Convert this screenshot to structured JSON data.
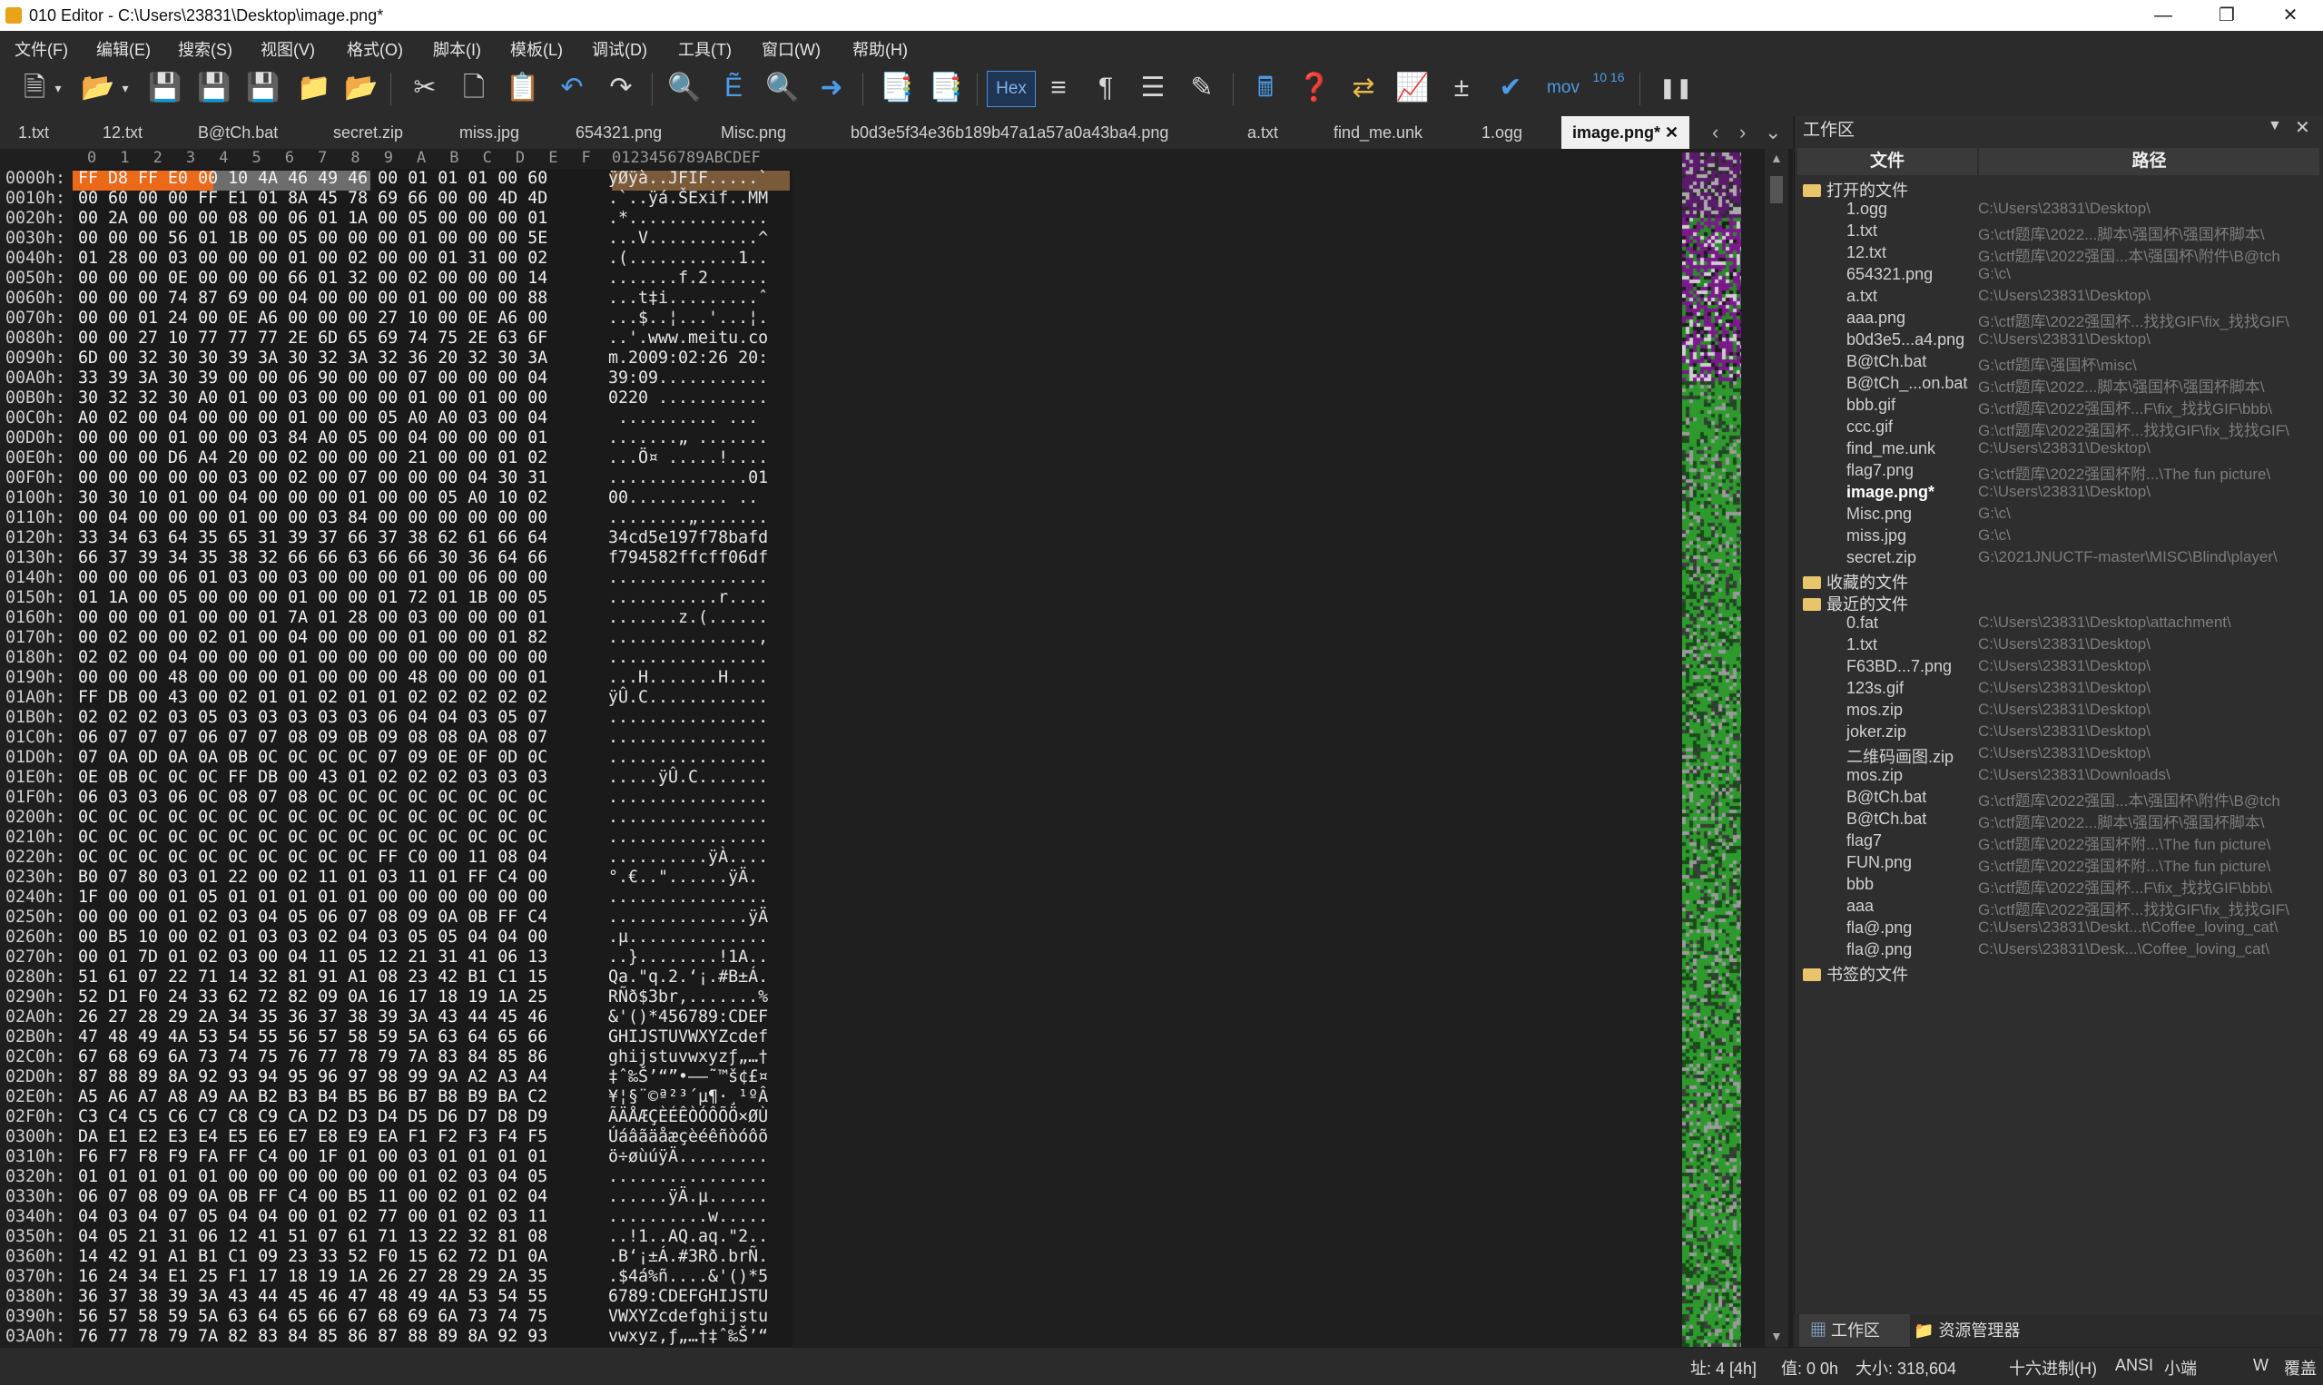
{
  "window": {
    "title": "010 Editor - C:\\Users\\23831\\Desktop\\image.png*"
  },
  "menu": [
    "文件(F)",
    "编辑(E)",
    "搜索(S)",
    "视图(V)",
    "格式(O)",
    "脚本(I)",
    "模板(L)",
    "调试(D)",
    "工具(T)",
    "窗口(W)",
    "帮助(H)"
  ],
  "toolbar": {
    "hex_label": "Hex",
    "mov_label": "mov",
    "base_label": "10 16"
  },
  "tabs": [
    "1.txt",
    "12.txt",
    "B@tCh.bat",
    "secret.zip",
    "miss.jpg",
    "654321.png",
    "Misc.png",
    "b0d3e5f34e36b189b47a1a57a0a43ba4.png",
    "a.txt",
    "find_me.unk",
    "1.ogg",
    "image.png*"
  ],
  "hex_header": {
    "cols": [
      "0",
      "1",
      "2",
      "3",
      "4",
      "5",
      "6",
      "7",
      "8",
      "9",
      "A",
      "B",
      "C",
      "D",
      "E",
      "F"
    ],
    "ascii": "0123456789ABCDEF"
  },
  "hex_rows": [
    {
      "a": "0000h:",
      "h": "FF D8 FF E0 00 10 4A 46 49 46 00 01 01 01 00 60",
      "s": "ÿØÿà..JFIF.....`"
    },
    {
      "a": "0010h:",
      "h": "00 60 00 00 FF E1 01 8A 45 78 69 66 00 00 4D 4D",
      "s": ".`..ÿá.ŠExif..MM"
    },
    {
      "a": "0020h:",
      "h": "00 2A 00 00 00 08 00 06 01 1A 00 05 00 00 00 01",
      "s": ".*.............."
    },
    {
      "a": "0030h:",
      "h": "00 00 00 56 01 1B 00 05 00 00 00 01 00 00 00 5E",
      "s": "...V...........^"
    },
    {
      "a": "0040h:",
      "h": "01 28 00 03 00 00 00 01 00 02 00 00 01 31 00 02",
      "s": ".(...........1.."
    },
    {
      "a": "0050h:",
      "h": "00 00 00 0E 00 00 00 66 01 32 00 02 00 00 00 14",
      "s": ".......f.2......"
    },
    {
      "a": "0060h:",
      "h": "00 00 00 74 87 69 00 04 00 00 00 01 00 00 00 88",
      "s": "...t‡i.........ˆ"
    },
    {
      "a": "0070h:",
      "h": "00 00 01 24 00 0E A6 00 00 00 27 10 00 0E A6 00",
      "s": "...$..¦...'...¦."
    },
    {
      "a": "0080h:",
      "h": "00 00 27 10 77 77 77 2E 6D 65 69 74 75 2E 63 6F",
      "s": "..'.www.meitu.co"
    },
    {
      "a": "0090h:",
      "h": "6D 00 32 30 30 39 3A 30 32 3A 32 36 20 32 30 3A",
      "s": "m.2009:02:26 20:"
    },
    {
      "a": "00A0h:",
      "h": "33 39 3A 30 39 00 00 06 90 00 00 07 00 00 00 04",
      "s": "39:09..........."
    },
    {
      "a": "00B0h:",
      "h": "30 32 32 30 A0 01 00 03 00 00 00 01 00 01 00 00",
      "s": "0220 ..........."
    },
    {
      "a": "00C0h:",
      "h": "A0 02 00 04 00 00 00 01 00 00 05 A0 A0 03 00 04",
      "s": " .......... ..."
    },
    {
      "a": "00D0h:",
      "h": "00 00 00 01 00 00 03 84 A0 05 00 04 00 00 00 01",
      "s": ".......„ ......."
    },
    {
      "a": "00E0h:",
      "h": "00 00 00 D6 A4 20 00 02 00 00 00 21 00 00 01 02",
      "s": "...Ö¤ .....!...."
    },
    {
      "a": "00F0h:",
      "h": "00 00 00 00 00 03 00 02 00 07 00 00 00 04 30 31",
      "s": "..............01"
    },
    {
      "a": "0100h:",
      "h": "30 30 10 01 00 04 00 00 00 01 00 00 05 A0 10 02",
      "s": "00.......... .."
    },
    {
      "a": "0110h:",
      "h": "00 04 00 00 00 01 00 00 03 84 00 00 00 00 00 00",
      "s": "........„......."
    },
    {
      "a": "0120h:",
      "h": "33 34 63 64 35 65 31 39 37 66 37 38 62 61 66 64",
      "s": "34cd5e197f78bafd"
    },
    {
      "a": "0130h:",
      "h": "66 37 39 34 35 38 32 66 66 63 66 66 30 36 64 66",
      "s": "f794582ffcff06df"
    },
    {
      "a": "0140h:",
      "h": "00 00 00 06 01 03 00 03 00 00 00 01 00 06 00 00",
      "s": "................"
    },
    {
      "a": "0150h:",
      "h": "01 1A 00 05 00 00 00 01 00 00 01 72 01 1B 00 05",
      "s": "...........r...."
    },
    {
      "a": "0160h:",
      "h": "00 00 00 01 00 00 01 7A 01 28 00 03 00 00 00 01",
      "s": ".......z.(......"
    },
    {
      "a": "0170h:",
      "h": "00 02 00 00 02 01 00 04 00 00 00 01 00 00 01 82",
      "s": "...............‚"
    },
    {
      "a": "0180h:",
      "h": "02 02 00 04 00 00 00 01 00 00 00 00 00 00 00 00",
      "s": "................"
    },
    {
      "a": "0190h:",
      "h": "00 00 00 48 00 00 00 01 00 00 00 48 00 00 00 01",
      "s": "...H.......H...."
    },
    {
      "a": "01A0h:",
      "h": "FF DB 00 43 00 02 01 01 02 01 01 02 02 02 02 02",
      "s": "ÿÛ.C............"
    },
    {
      "a": "01B0h:",
      "h": "02 02 02 03 05 03 03 03 03 03 06 04 04 03 05 07",
      "s": "................"
    },
    {
      "a": "01C0h:",
      "h": "06 07 07 07 06 07 07 08 09 0B 09 08 08 0A 08 07",
      "s": "................"
    },
    {
      "a": "01D0h:",
      "h": "07 0A 0D 0A 0A 0B 0C 0C 0C 0C 07 09 0E 0F 0D 0C",
      "s": "................"
    },
    {
      "a": "01E0h:",
      "h": "0E 0B 0C 0C 0C FF DB 00 43 01 02 02 02 03 03 03",
      "s": ".....ÿÛ.C......."
    },
    {
      "a": "01F0h:",
      "h": "06 03 03 06 0C 08 07 08 0C 0C 0C 0C 0C 0C 0C 0C",
      "s": "................"
    },
    {
      "a": "0200h:",
      "h": "0C 0C 0C 0C 0C 0C 0C 0C 0C 0C 0C 0C 0C 0C 0C 0C",
      "s": "................"
    },
    {
      "a": "0210h:",
      "h": "0C 0C 0C 0C 0C 0C 0C 0C 0C 0C 0C 0C 0C 0C 0C 0C",
      "s": "................"
    },
    {
      "a": "0220h:",
      "h": "0C 0C 0C 0C 0C 0C 0C 0C 0C 0C FF C0 00 11 08 04",
      "s": "..........ÿÀ...."
    },
    {
      "a": "0230h:",
      "h": "B0 07 80 03 01 22 00 02 11 01 03 11 01 FF C4 00",
      "s": "°.€..\"......ÿÄ."
    },
    {
      "a": "0240h:",
      "h": "1F 00 00 01 05 01 01 01 01 01 00 00 00 00 00 00",
      "s": "................"
    },
    {
      "a": "0250h:",
      "h": "00 00 00 01 02 03 04 05 06 07 08 09 0A 0B FF C4",
      "s": "..............ÿÄ"
    },
    {
      "a": "0260h:",
      "h": "00 B5 10 00 02 01 03 03 02 04 03 05 05 04 04 00",
      "s": ".µ.............."
    },
    {
      "a": "0270h:",
      "h": "00 01 7D 01 02 03 00 04 11 05 12 21 31 41 06 13",
      "s": "..}........!1A.."
    },
    {
      "a": "0280h:",
      "h": "51 61 07 22 71 14 32 81 91 A1 08 23 42 B1 C1 15",
      "s": "Qa.\"q.2.‘¡.#B±Á."
    },
    {
      "a": "0290h:",
      "h": "52 D1 F0 24 33 62 72 82 09 0A 16 17 18 19 1A 25",
      "s": "RÑð$3br‚.......%"
    },
    {
      "a": "02A0h:",
      "h": "26 27 28 29 2A 34 35 36 37 38 39 3A 43 44 45 46",
      "s": "&'()*456789:CDEF"
    },
    {
      "a": "02B0h:",
      "h": "47 48 49 4A 53 54 55 56 57 58 59 5A 63 64 65 66",
      "s": "GHIJSTUVWXYZcdef"
    },
    {
      "a": "02C0h:",
      "h": "67 68 69 6A 73 74 75 76 77 78 79 7A 83 84 85 86",
      "s": "ghijstuvwxyzƒ„…†"
    },
    {
      "a": "02D0h:",
      "h": "87 88 89 8A 92 93 94 95 96 97 98 99 9A A2 A3 A4",
      "s": "‡ˆ‰Š’“”•–—˜™š¢£¤"
    },
    {
      "a": "02E0h:",
      "h": "A5 A6 A7 A8 A9 AA B2 B3 B4 B5 B6 B7 B8 B9 BA C2",
      "s": "¥¦§¨©ª²³´µ¶·¸¹ºÂ"
    },
    {
      "a": "02F0h:",
      "h": "C3 C4 C5 C6 C7 C8 C9 CA D2 D3 D4 D5 D6 D7 D8 D9",
      "s": "ÃÄÅÆÇÈÉÊÒÓÔÕÖ×ØÙ"
    },
    {
      "a": "0300h:",
      "h": "DA E1 E2 E3 E4 E5 E6 E7 E8 E9 EA F1 F2 F3 F4 F5",
      "s": "Úáâãäåæçèéêñòóôõ"
    },
    {
      "a": "0310h:",
      "h": "F6 F7 F8 F9 FA FF C4 00 1F 01 00 03 01 01 01 01",
      "s": "ö÷øùúÿÄ........."
    },
    {
      "a": "0320h:",
      "h": "01 01 01 01 01 00 00 00 00 00 00 01 02 03 04 05",
      "s": "................"
    },
    {
      "a": "0330h:",
      "h": "06 07 08 09 0A 0B FF C4 00 B5 11 00 02 01 02 04",
      "s": "......ÿÄ.µ......"
    },
    {
      "a": "0340h:",
      "h": "04 03 04 07 05 04 04 00 01 02 77 00 01 02 03 11",
      "s": "..........w....."
    },
    {
      "a": "0350h:",
      "h": "04 05 21 31 06 12 41 51 07 61 71 13 22 32 81 08",
      "s": "..!1..AQ.aq.\"2.."
    },
    {
      "a": "0360h:",
      "h": "14 42 91 A1 B1 C1 09 23 33 52 F0 15 62 72 D1 0A",
      "s": ".B‘¡±Á.#3Rð.brÑ."
    },
    {
      "a": "0370h:",
      "h": "16 24 34 E1 25 F1 17 18 19 1A 26 27 28 29 2A 35",
      "s": ".$4á%ñ....&'()*5"
    },
    {
      "a": "0380h:",
      "h": "36 37 38 39 3A 43 44 45 46 47 48 49 4A 53 54 55",
      "s": "6789:CDEFGHIJSTU"
    },
    {
      "a": "0390h:",
      "h": "56 57 58 59 5A 63 64 65 66 67 68 69 6A 73 74 75",
      "s": "VWXYZcdefghijstu"
    },
    {
      "a": "03A0h:",
      "h": "76 77 78 79 7A 82 83 84 85 86 87 88 89 8A 92 93",
      "s": "vwxyz‚ƒ„…†‡ˆ‰Š’“"
    }
  ],
  "workspace": {
    "title": "工作区",
    "col_file": "文件",
    "col_path": "路径",
    "open_files_label": "打开的文件",
    "open_files": [
      {
        "n": "1.ogg",
        "p": "C:\\Users\\23831\\Desktop\\"
      },
      {
        "n": "1.txt",
        "p": "G:\\ctf题库\\2022...脚本\\强国杯\\强国杯脚本\\"
      },
      {
        "n": "12.txt",
        "p": "G:\\ctf题库\\2022强国...本\\强国杯\\附件\\B@tch"
      },
      {
        "n": "654321.png",
        "p": "G:\\c\\"
      },
      {
        "n": "a.txt",
        "p": "C:\\Users\\23831\\Desktop\\"
      },
      {
        "n": "aaa.png",
        "p": "G:\\ctf题库\\2022强国杯...找找GIF\\fix_找找GIF\\"
      },
      {
        "n": "b0d3e5...a4.png",
        "p": "C:\\Users\\23831\\Desktop\\"
      },
      {
        "n": "B@tCh.bat",
        "p": "G:\\ctf题库\\强国杯\\misc\\"
      },
      {
        "n": "B@tCh_...on.bat",
        "p": "G:\\ctf题库\\2022...脚本\\强国杯\\强国杯脚本\\"
      },
      {
        "n": "bbb.gif",
        "p": "G:\\ctf题库\\2022强国杯...F\\fix_找找GIF\\bbb\\"
      },
      {
        "n": "ccc.gif",
        "p": "G:\\ctf题库\\2022强国杯...找找GIF\\fix_找找GIF\\"
      },
      {
        "n": "find_me.unk",
        "p": "C:\\Users\\23831\\Desktop\\"
      },
      {
        "n": "flag7.png",
        "p": "G:\\ctf题库\\2022强国杯附...\\The fun picture\\"
      },
      {
        "n": "image.png*",
        "p": "C:\\Users\\23831\\Desktop\\"
      },
      {
        "n": "Misc.png",
        "p": "G:\\c\\"
      },
      {
        "n": "miss.jpg",
        "p": "G:\\c\\"
      },
      {
        "n": "secret.zip",
        "p": "G:\\2021JNUCTF-master\\MISC\\Blind\\player\\"
      }
    ],
    "favorites_label": "收藏的文件",
    "recent_label": "最近的文件",
    "recent_files": [
      {
        "n": "0.fat",
        "p": "C:\\Users\\23831\\Desktop\\attachment\\"
      },
      {
        "n": "1.txt",
        "p": "C:\\Users\\23831\\Desktop\\"
      },
      {
        "n": "F63BD...7.png",
        "p": "C:\\Users\\23831\\Desktop\\"
      },
      {
        "n": "123s.gif",
        "p": "C:\\Users\\23831\\Desktop\\"
      },
      {
        "n": "mos.zip",
        "p": "C:\\Users\\23831\\Desktop\\"
      },
      {
        "n": "joker.zip",
        "p": "C:\\Users\\23831\\Desktop\\"
      },
      {
        "n": "二维码画图.zip",
        "p": "C:\\Users\\23831\\Desktop\\"
      },
      {
        "n": "mos.zip",
        "p": "C:\\Users\\23831\\Downloads\\"
      },
      {
        "n": "B@tCh.bat",
        "p": "G:\\ctf题库\\2022强国...本\\强国杯\\附件\\B@tch"
      },
      {
        "n": "B@tCh.bat",
        "p": "G:\\ctf题库\\2022...脚本\\强国杯\\强国杯脚本\\"
      },
      {
        "n": "flag7",
        "p": "G:\\ctf题库\\2022强国杯附...\\The fun picture\\"
      },
      {
        "n": "FUN.png",
        "p": "G:\\ctf题库\\2022强国杯附...\\The fun picture\\"
      },
      {
        "n": "bbb",
        "p": "G:\\ctf题库\\2022强国杯...F\\fix_找找GIF\\bbb\\"
      },
      {
        "n": "aaa",
        "p": "G:\\ctf题库\\2022强国杯...找找GIF\\fix_找找GIF\\"
      },
      {
        "n": "fla@.png",
        "p": "C:\\Users\\23831\\Deskt...t\\Coffee_loving_cat\\"
      },
      {
        "n": "fla@.png",
        "p": "C:\\Users\\23831\\Desk...\\Coffee_loving_cat\\"
      }
    ],
    "bookmarks_label": "书签的文件",
    "tab_workspace": "工作区",
    "tab_explorer": "资源管理器"
  },
  "status": {
    "address": "址: 4 [4h]",
    "value": "值: 0 0h",
    "size": "大小: 318,604",
    "mode": "十六进制(H)",
    "encoding": "ANSI",
    "endian": "小端",
    "w": "W",
    "overwrite": "覆盖"
  }
}
